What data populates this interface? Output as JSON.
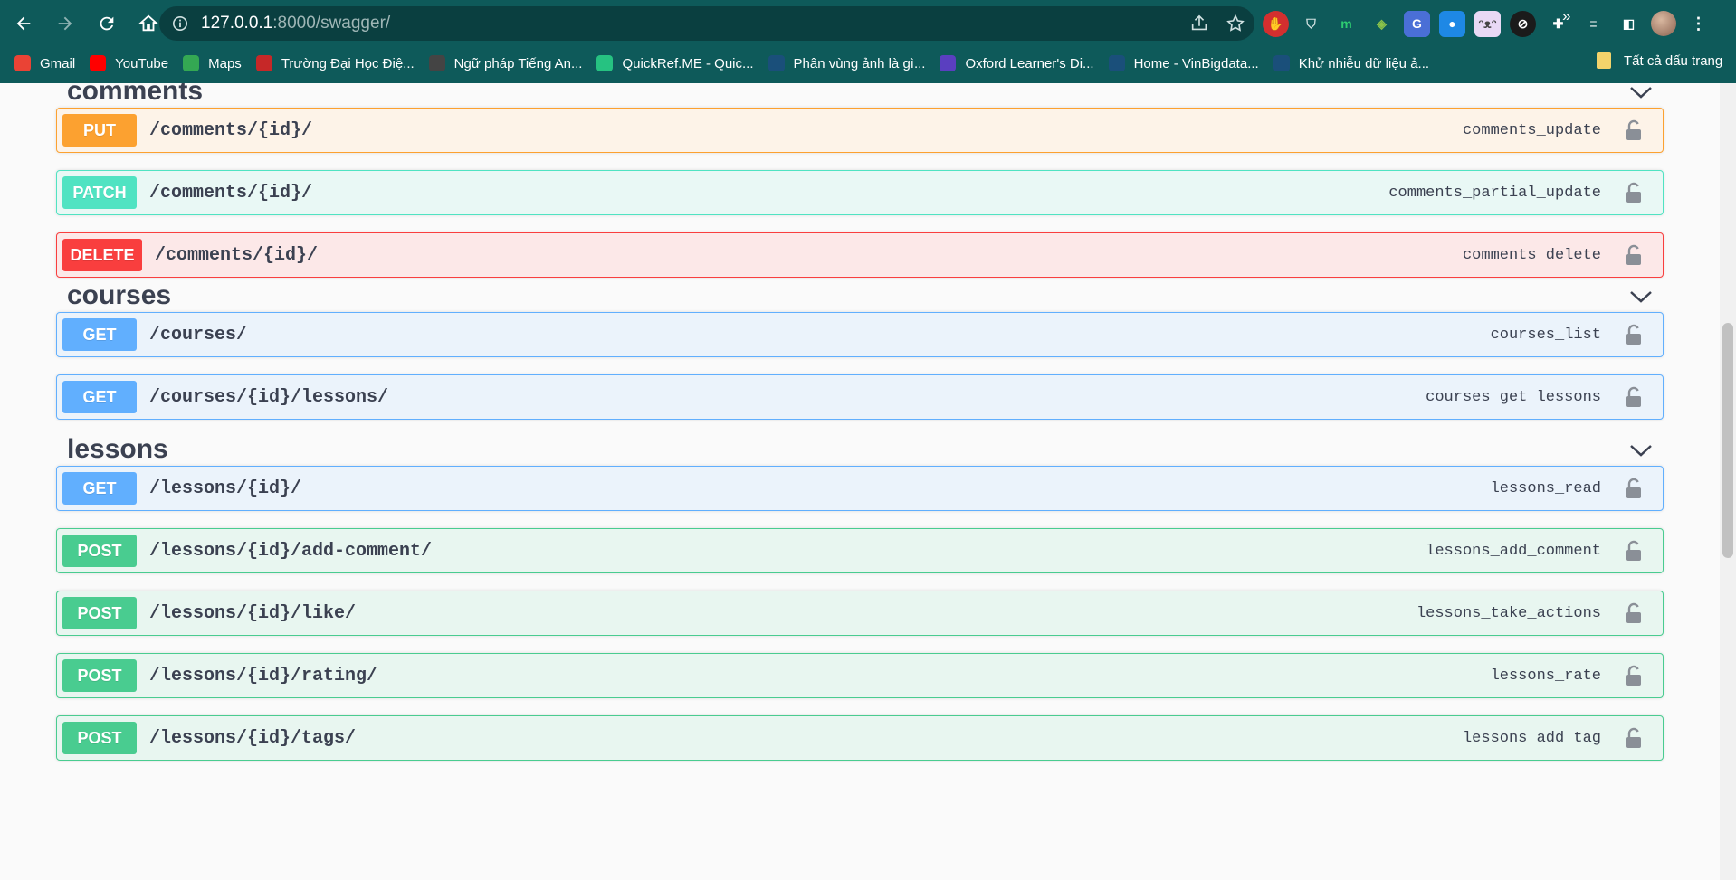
{
  "browser": {
    "url_host": "127.0.0.1",
    "url_rest": ":8000/swagger/",
    "bookmarks": [
      {
        "label": "Gmail",
        "icon": "gmail-icon",
        "color": "#ea4335"
      },
      {
        "label": "YouTube",
        "icon": "youtube-icon",
        "color": "#ff0000"
      },
      {
        "label": "Maps",
        "icon": "maps-icon",
        "color": "#34a853"
      },
      {
        "label": "Trường Đại Học Điệ...",
        "icon": "university-icon",
        "color": "#c62828"
      },
      {
        "label": "Ngữ pháp Tiếng An...",
        "icon": "grammar-icon",
        "color": "#444444"
      },
      {
        "label": "QuickRef.ME - Quic...",
        "icon": "quickref-icon",
        "color": "#26c281"
      },
      {
        "label": "Phân vùng ảnh là gì...",
        "icon": "heart-icon",
        "color": "#1a4f7a"
      },
      {
        "label": "Oxford Learner's Di...",
        "icon": "oxford-icon",
        "color": "#5a3fc0"
      },
      {
        "label": "Home - VinBigdata...",
        "icon": "heart-icon",
        "color": "#1a4f7a"
      },
      {
        "label": "Khử nhiễu dữ liệu ả...",
        "icon": "heart-icon",
        "color": "#1a4f7a"
      }
    ],
    "more_label": "»",
    "all_bookmarks_label": "Tất cả dấu trang"
  },
  "sections": [
    {
      "title": "comments",
      "operations": [
        {
          "method": "PUT",
          "path": "/comments/{id}/",
          "operation_id": "comments_update"
        },
        {
          "method": "PATCH",
          "path": "/comments/{id}/",
          "operation_id": "comments_partial_update"
        },
        {
          "method": "DELETE",
          "path": "/comments/{id}/",
          "operation_id": "comments_delete"
        }
      ]
    },
    {
      "title": "courses",
      "operations": [
        {
          "method": "GET",
          "path": "/courses/",
          "operation_id": "courses_list"
        },
        {
          "method": "GET",
          "path": "/courses/{id}/lessons/",
          "operation_id": "courses_get_lessons"
        }
      ]
    },
    {
      "title": "lessons",
      "operations": [
        {
          "method": "GET",
          "path": "/lessons/{id}/",
          "operation_id": "lessons_read"
        },
        {
          "method": "POST",
          "path": "/lessons/{id}/add-comment/",
          "operation_id": "lessons_add_comment"
        },
        {
          "method": "POST",
          "path": "/lessons/{id}/like/",
          "operation_id": "lessons_take_actions"
        },
        {
          "method": "POST",
          "path": "/lessons/{id}/rating/",
          "operation_id": "lessons_rate"
        },
        {
          "method": "POST",
          "path": "/lessons/{id}/tags/",
          "operation_id": "lessons_add_tag"
        }
      ]
    }
  ],
  "method_colors": {
    "PUT": {
      "badge": "#fca130",
      "bg": "#fdf3e8",
      "border": "#fca130"
    },
    "PATCH": {
      "badge": "#50e3c2",
      "bg": "#e9f8f5",
      "border": "#50e3c2"
    },
    "DELETE": {
      "badge": "#f93e3e",
      "bg": "#fce8e8",
      "border": "#f93e3e"
    },
    "GET": {
      "badge": "#61affe",
      "bg": "#ebf3fb",
      "border": "#61affe"
    },
    "POST": {
      "badge": "#49cc90",
      "bg": "#e8f6f0",
      "border": "#49cc90"
    }
  }
}
